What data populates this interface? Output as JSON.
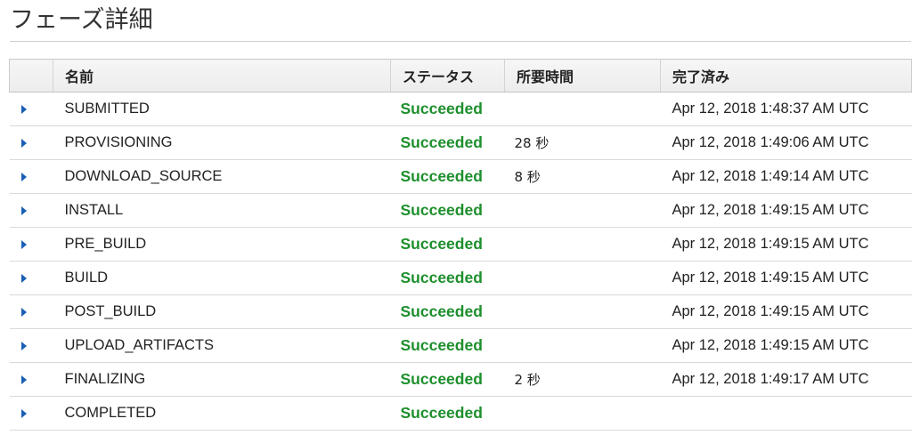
{
  "page": {
    "title": "フェーズ詳細"
  },
  "table": {
    "columns": {
      "name": "名前",
      "status": "ステータス",
      "duration": "所要時間",
      "completed": "完了済み"
    },
    "expand_icon": "caret-right-icon",
    "colors": {
      "status_succeeded": "#1d8f2c",
      "expand_icon": "#1a5fb4"
    },
    "rows": [
      {
        "name": "SUBMITTED",
        "status": "Succeeded",
        "duration": "",
        "completed": "Apr 12, 2018 1:48:37 AM UTC"
      },
      {
        "name": "PROVISIONING",
        "status": "Succeeded",
        "duration": "28 秒",
        "completed": "Apr 12, 2018 1:49:06 AM UTC"
      },
      {
        "name": "DOWNLOAD_SOURCE",
        "status": "Succeeded",
        "duration": "8 秒",
        "completed": "Apr 12, 2018 1:49:14 AM UTC"
      },
      {
        "name": "INSTALL",
        "status": "Succeeded",
        "duration": "",
        "completed": "Apr 12, 2018 1:49:15 AM UTC"
      },
      {
        "name": "PRE_BUILD",
        "status": "Succeeded",
        "duration": "",
        "completed": "Apr 12, 2018 1:49:15 AM UTC"
      },
      {
        "name": "BUILD",
        "status": "Succeeded",
        "duration": "",
        "completed": "Apr 12, 2018 1:49:15 AM UTC"
      },
      {
        "name": "POST_BUILD",
        "status": "Succeeded",
        "duration": "",
        "completed": "Apr 12, 2018 1:49:15 AM UTC"
      },
      {
        "name": "UPLOAD_ARTIFACTS",
        "status": "Succeeded",
        "duration": "",
        "completed": "Apr 12, 2018 1:49:15 AM UTC"
      },
      {
        "name": "FINALIZING",
        "status": "Succeeded",
        "duration": "2 秒",
        "completed": "Apr 12, 2018 1:49:17 AM UTC"
      },
      {
        "name": "COMPLETED",
        "status": "Succeeded",
        "duration": "",
        "completed": ""
      }
    ]
  }
}
